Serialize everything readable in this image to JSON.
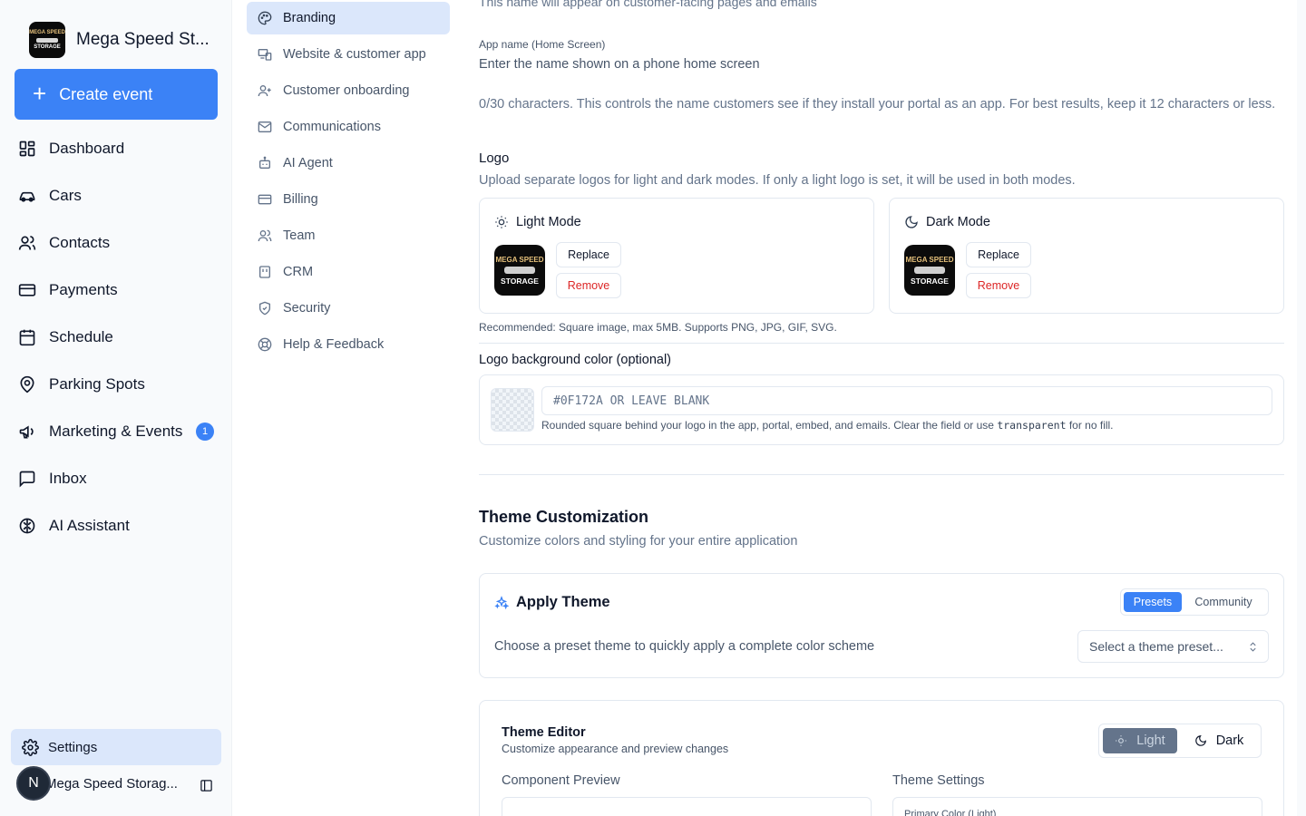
{
  "brand": {
    "name": "Mega Speed St...",
    "logo_line1": "MEGA SPEED",
    "logo_line2": "STORAGE"
  },
  "sidebar": {
    "create_label": "Create event",
    "items": [
      {
        "label": "Dashboard",
        "icon": "dashboard-icon"
      },
      {
        "label": "Cars",
        "icon": "car-icon"
      },
      {
        "label": "Contacts",
        "icon": "users-icon"
      },
      {
        "label": "Payments",
        "icon": "credit-card-icon"
      },
      {
        "label": "Schedule",
        "icon": "calendar-icon"
      },
      {
        "label": "Parking Spots",
        "icon": "map-pin-icon"
      },
      {
        "label": "Marketing & Events",
        "icon": "megaphone-icon",
        "badge": "1"
      },
      {
        "label": "Inbox",
        "icon": "message-square-icon"
      },
      {
        "label": "AI Assistant",
        "icon": "brain-icon"
      }
    ],
    "settings_label": "Settings",
    "account": {
      "initial": "N",
      "name": "Mega Speed Storag..."
    }
  },
  "subnav": {
    "items": [
      {
        "label": "Branding",
        "icon": "palette-icon",
        "active": true
      },
      {
        "label": "Website & customer app",
        "icon": "devices-icon"
      },
      {
        "label": "Customer onboarding",
        "icon": "user-plus-icon"
      },
      {
        "label": "Communications",
        "icon": "mail-icon"
      },
      {
        "label": "AI Agent",
        "icon": "bot-icon"
      },
      {
        "label": "Billing",
        "icon": "credit-card-icon"
      },
      {
        "label": "Team",
        "icon": "users-icon"
      },
      {
        "label": "CRM",
        "icon": "crm-icon"
      },
      {
        "label": "Security",
        "icon": "shield-icon"
      },
      {
        "label": "Help & Feedback",
        "icon": "life-buoy-icon"
      }
    ]
  },
  "content": {
    "cut_text": "This name will appear on customer-facing pages and emails",
    "app_name_label": "App name (Home Screen)",
    "app_name_placeholder": "Enter the name shown on a phone home screen",
    "app_name_hint": "0/30 characters. This controls the name customers see if they install your portal as an app. For best results, keep it 12 characters or less.",
    "logo_title": "Logo",
    "logo_desc": "Upload separate logos for light and dark modes. If only a light logo is set, it will be used in both modes.",
    "light_mode_label": "Light Mode",
    "dark_mode_label": "Dark Mode",
    "replace_label": "Replace",
    "remove_label": "Remove",
    "recommend": "Recommended: Square image, max 5MB. Supports PNG, JPG, GIF, SVG.",
    "bg_label": "Logo background color (optional)",
    "bg_placeholder": "#0F172A OR LEAVE BLANK",
    "bg_hint_pre": "Rounded square behind your logo in the app, portal, embed, and emails. Clear the field or use ",
    "bg_hint_code": "transparent",
    "bg_hint_post": " for no fill.",
    "theme_title": "Theme Customization",
    "theme_desc": "Customize colors and styling for your entire application",
    "apply_title": "Apply Theme",
    "presets_label": "Presets",
    "community_label": "Community",
    "apply_desc": "Choose a preset theme to quickly apply a complete color scheme",
    "select_placeholder": "Select a theme preset...",
    "editor_title": "Theme Editor",
    "editor_sub": "Customize appearance and preview changes",
    "light_label": "Light",
    "dark_label": "Dark",
    "preview_label": "Component Preview",
    "settings_label": "Theme Settings",
    "primary_color_label": "Primary Color (Light)"
  },
  "colors": {
    "accent": "#3b82f6",
    "danger": "#dc2626",
    "active_bg": "#dbe7fb"
  }
}
